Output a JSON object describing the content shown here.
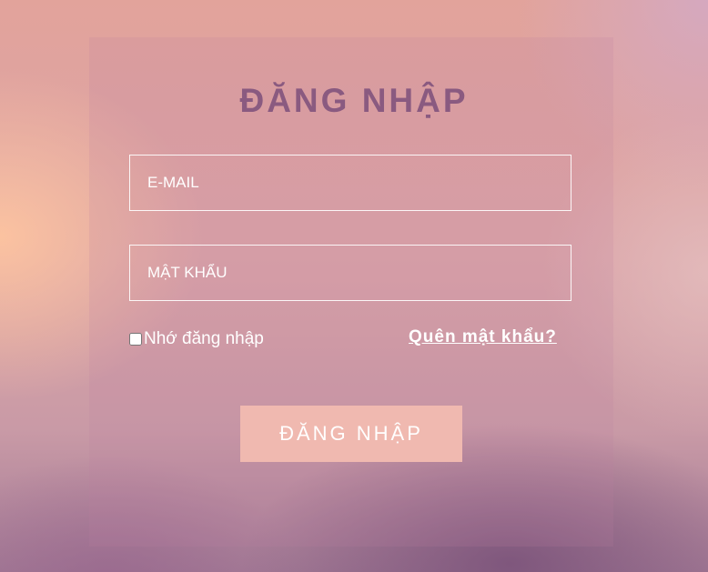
{
  "form": {
    "title": "ĐĂNG NHẬP",
    "email_placeholder": "E-MAIL",
    "password_placeholder": "MẬT KHẨU",
    "remember_label": "Nhớ đăng nhập",
    "forgot_link": "Quên mật khẩu?",
    "submit_label": "ĐĂNG NHẬP"
  },
  "colors": {
    "title": "#8a5a80",
    "button_bg": "#f0b9b0",
    "text": "#ffffff"
  }
}
